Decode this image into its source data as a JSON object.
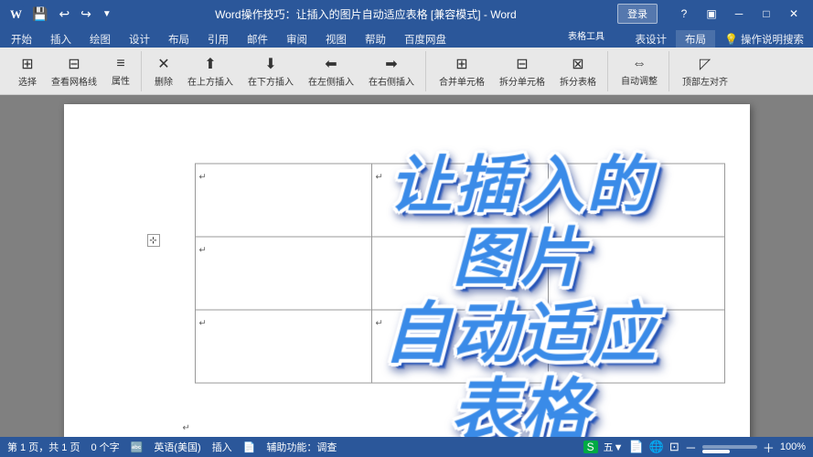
{
  "titlebar": {
    "title": "Word操作技巧：让插入的图片自动适应表格 [兼容模式] - Word",
    "app_name": "Word",
    "login_label": "登录",
    "minimize_icon": "─",
    "restore_icon": "□",
    "close_icon": "✕",
    "table_tools_label": "表格工具"
  },
  "quickaccess": {
    "save": "💾",
    "undo": "↩",
    "redo": "↪"
  },
  "tabs": {
    "main": [
      {
        "label": "开始",
        "active": false
      },
      {
        "label": "插入",
        "active": false
      },
      {
        "label": "绘图",
        "active": false
      },
      {
        "label": "设计",
        "active": false
      },
      {
        "label": "布局",
        "active": false
      },
      {
        "label": "引用",
        "active": false
      },
      {
        "label": "邮件",
        "active": false
      },
      {
        "label": "审阅",
        "active": false
      },
      {
        "label": "视图",
        "active": false
      },
      {
        "label": "帮助",
        "active": false
      },
      {
        "label": "百度网盘",
        "active": false
      }
    ],
    "table_tools": [
      {
        "label": "表设计",
        "active": false
      },
      {
        "label": "布局",
        "active": true
      }
    ],
    "search_placeholder": "操作说明搜索"
  },
  "document": {
    "big_title": "让插入的\n图片\n自动适应\n表格"
  },
  "statusbar": {
    "pages": "第 1 页，共 1 页",
    "words": "0 个字",
    "language": "英语(美国)",
    "insert_mode": "插入",
    "accessibility": "辅助功能：调查",
    "brand": "五▼",
    "zoom": "100%"
  }
}
